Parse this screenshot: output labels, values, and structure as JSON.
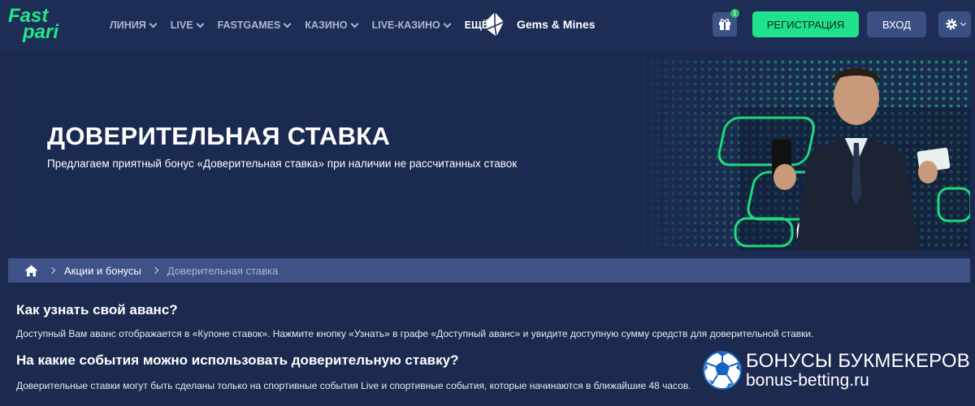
{
  "header": {
    "logo_line1": "Fast",
    "logo_line2": "pari",
    "nav": [
      "ЛИНИЯ",
      "LIVE",
      "FASTGAMES",
      "КАЗИНО",
      "LIVE-КАЗИНО",
      "ЕЩЁ"
    ],
    "gems_label": "Gems & Mines",
    "gift_badge": "1",
    "register_label": "РЕГИСТРАЦИЯ",
    "login_label": "ВХОД"
  },
  "banner": {
    "title": "ДОВЕРИТЕЛЬНАЯ СТАВКА",
    "subtitle": "Предлагаем приятный бонус «Доверительная ставка» при наличии не рассчитанных ставок"
  },
  "breadcrumb": {
    "item1": "Акции и бонусы",
    "current": "Доверительная ставка"
  },
  "content": {
    "h1": "Как узнать свой аванс?",
    "p1": "Доступный Вам аванс отображается в «Купоне ставок». Нажмите кнопку «Узнать» в графе «Доступный аванс» и увидите доступную сумму средств для доверительной ставки.",
    "h2": "На какие события можно использовать доверительную ставку?",
    "p2": "Доверительные ставки могут быть сделаны только на спортивные события Live и спортивные события, которые начинаются в ближайшие 48 часов."
  },
  "watermark": {
    "line1": "БОНУСЫ БУКМЕКЕРОВ",
    "line2": "bonus-betting.ru"
  },
  "colors": {
    "accent": "#1ee38a",
    "header_bg": "#1d2d55",
    "page_bg": "#1b2a4e",
    "breadcrumb_bg": "#3e5287"
  }
}
